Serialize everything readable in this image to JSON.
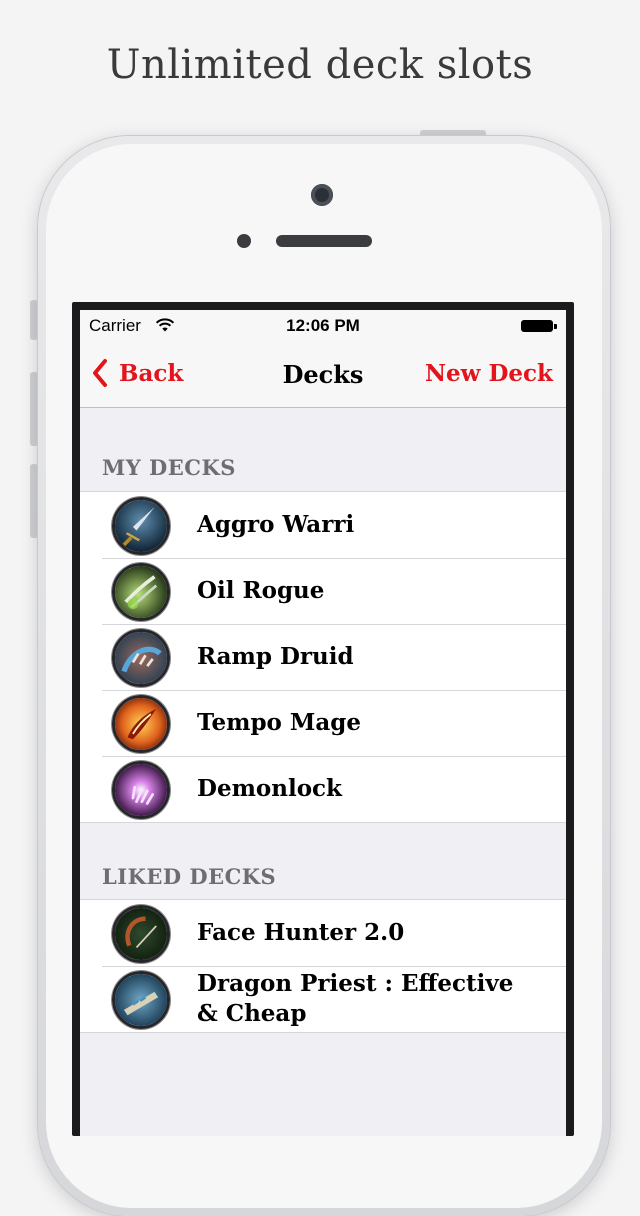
{
  "headline": "Unlimited deck slots",
  "status_bar": {
    "carrier": "Carrier",
    "time": "12:06 PM",
    "wifi_icon": "wifi-icon",
    "battery_icon": "battery-icon"
  },
  "nav": {
    "back_label": "Back",
    "title": "Decks",
    "new_deck_label": "New Deck",
    "accent_color": "#e2141c"
  },
  "sections": {
    "my_decks": {
      "title": "MY DECKS",
      "decks": [
        {
          "name": "Aggro Warri",
          "icon": "warrior-sword-icon"
        },
        {
          "name": "Oil Rogue",
          "icon": "rogue-blades-icon"
        },
        {
          "name": "Ramp Druid",
          "icon": "druid-claw-icon"
        },
        {
          "name": "Tempo Mage",
          "icon": "mage-fire-icon"
        },
        {
          "name": "Demonlock",
          "icon": "warlock-hand-icon"
        }
      ]
    },
    "liked_decks": {
      "title": "LIKED DECKS",
      "decks": [
        {
          "name": "Face Hunter 2.0",
          "icon": "hunter-bow-icon"
        },
        {
          "name": "Dragon Priest : Effective & Cheap",
          "icon": "priest-staff-icon"
        }
      ]
    }
  }
}
